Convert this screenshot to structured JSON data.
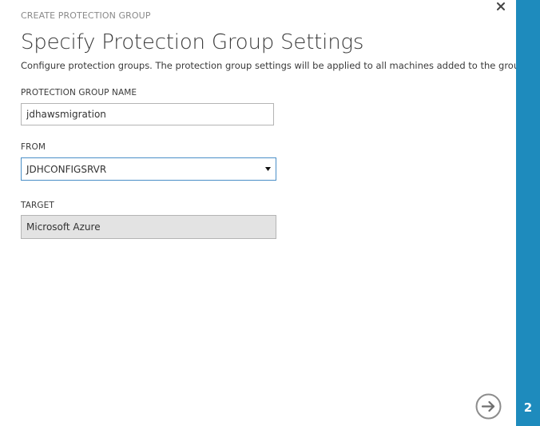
{
  "wizard": {
    "title": "CREATE PROTECTION GROUP",
    "close_icon": "close-icon",
    "next_icon": "arrow-right-circle-icon"
  },
  "page": {
    "title": "Specify Protection Group Settings",
    "description": "Configure protection groups. The protection group settings will be applied to all machines added to the group."
  },
  "fields": {
    "name": {
      "label": "PROTECTION GROUP NAME",
      "value": "jdhawsmigration"
    },
    "from": {
      "label": "FROM",
      "selected": "JDHCONFIGSRVR"
    },
    "target": {
      "label": "TARGET",
      "value": "Microsoft Azure"
    }
  },
  "steps": {
    "current": "2"
  },
  "colors": {
    "accent": "#1e8bbd",
    "focus_border": "#4a8fc7",
    "readonly_bg": "#e3e3e3"
  }
}
